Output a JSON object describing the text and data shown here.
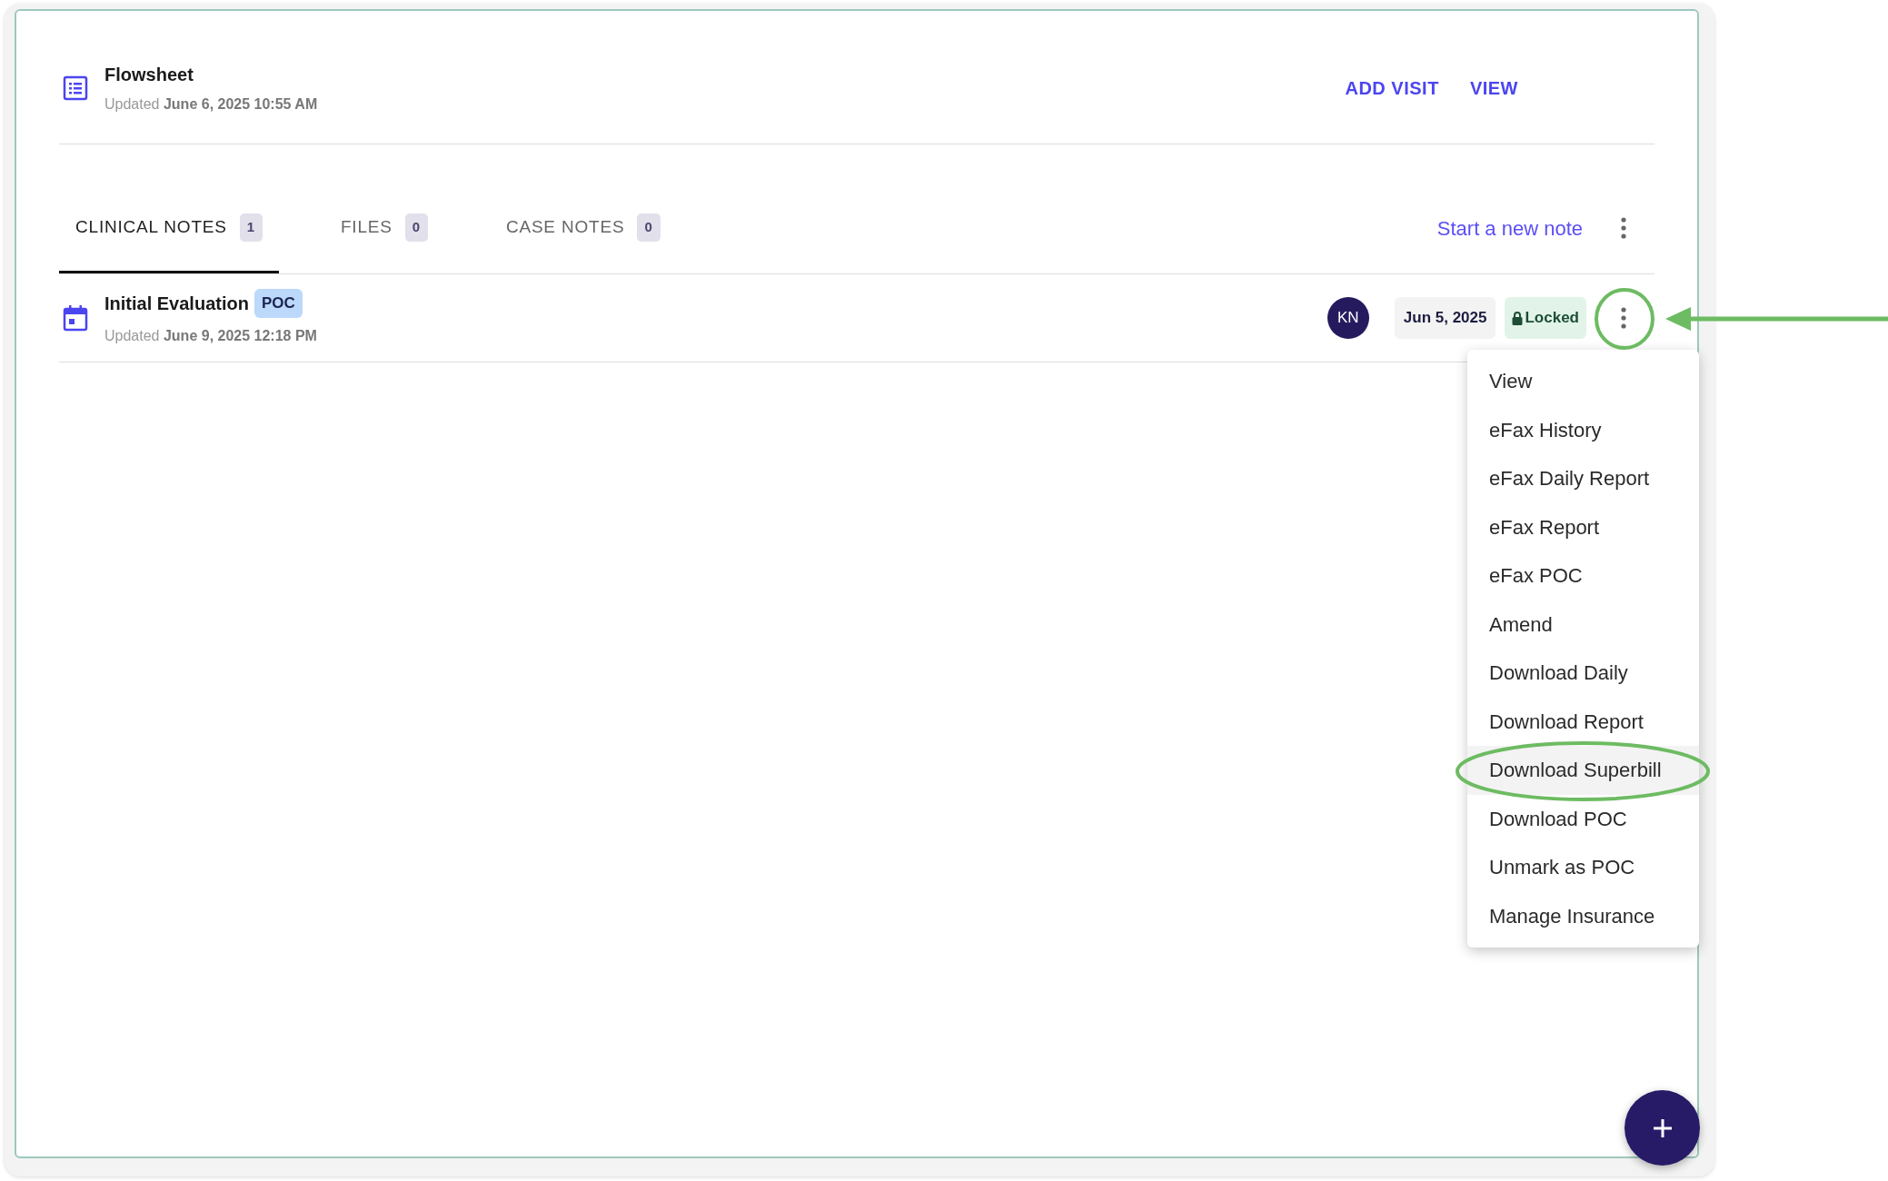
{
  "flowsheet": {
    "title": "Flowsheet",
    "updated": "Updated **June 6, 2025 10:55 AM**",
    "actions": [
      "ADD VISIT",
      "VIEW"
    ]
  },
  "tabs": [
    {
      "label": "CLINICAL NOTES",
      "count": "1",
      "selected": true
    },
    {
      "label": "FILES",
      "count": "0",
      "selected": false
    },
    {
      "label": "CASE NOTES",
      "count": "0",
      "selected": false
    }
  ],
  "new_note_link": "Start a new note",
  "notes": [
    {
      "title": "Initial Evaluation",
      "badge": "POC",
      "updated": "Updated **June 9, 2025 12:18 PM**",
      "avatar": "KN",
      "date": "Jun 5, 2025",
      "status": "Locked"
    }
  ],
  "menu": [
    {
      "label": "View",
      "selected": false
    },
    {
      "label": "eFax History",
      "selected": false
    },
    {
      "label": "eFax Daily Report",
      "selected": false
    },
    {
      "label": "eFax Report",
      "selected": false
    },
    {
      "label": "eFax POC",
      "selected": false
    },
    {
      "label": "Amend",
      "selected": false
    },
    {
      "label": "Download Daily",
      "selected": false
    },
    {
      "label": "Download Report",
      "selected": false
    },
    {
      "label": "Download Superbill",
      "selected": true
    },
    {
      "label": "Download POC",
      "selected": false
    },
    {
      "label": "Unmark as POC",
      "selected": false
    },
    {
      "label": "Manage Insurance",
      "selected": false
    }
  ]
}
